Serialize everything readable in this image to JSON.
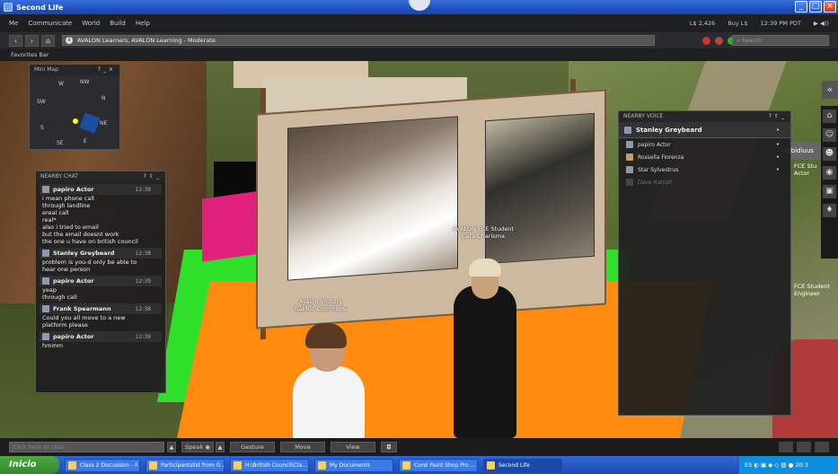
{
  "window": {
    "title": "Second Life"
  },
  "menu": {
    "items": [
      "Me",
      "Communicate",
      "World",
      "Build",
      "Help"
    ],
    "balance": "L$ 2,426",
    "buy": "Buy L$",
    "time": "12:39 PM PDT"
  },
  "nav": {
    "location": "AVALON Learners, AVALON Learning - Moderate",
    "search_placeholder": "Search"
  },
  "favorites": {
    "label": "Favorites Bar"
  },
  "minimap": {
    "title": "Mini Map",
    "compass": {
      "n": "N",
      "nw": "NW",
      "w": "W",
      "sw": "SW",
      "s": "S",
      "se": "SE",
      "e": "E",
      "ne": "NE"
    }
  },
  "chat": {
    "title": "NEARBY CHAT",
    "messages": [
      {
        "name": "papiro Actor",
        "time": "12:38",
        "lines": [
          "i mean phone call",
          "through landline",
          "ereal call",
          "real*",
          "also i tried to email",
          "but the email doesnt work",
          "the one u have on british council"
        ]
      },
      {
        "name": "Stanley Greybeard",
        "time": "12:38",
        "lines": [
          "problem is you-d only be able to",
          "hear one person"
        ]
      },
      {
        "name": "papiro Actor",
        "time": "12:39",
        "lines": [
          "yeap",
          "through call"
        ]
      },
      {
        "name": "Frank Spearmann",
        "time": "12:38",
        "lines": [
          "Could you all move to a new",
          "platform please"
        ]
      },
      {
        "name": "papiro Actor",
        "time": "12:39",
        "lines": [
          "hmmm"
        ]
      }
    ]
  },
  "voice": {
    "title": "NEARBY VOICE",
    "self": "Stanley Greybeard",
    "participants": [
      "papiro Actor",
      "Rossella Fiorenza",
      "Star Sylvestrus",
      "Dave Ratroit"
    ]
  },
  "scene": {
    "tag_visitors": "Avalon Visitors",
    "tag_visitor_name": "Baldric Commons",
    "tag_student": "AVALON FCE Student",
    "tag_student_name": "Cata Charisma",
    "ambidi": "Ambidiuus",
    "fce_top": "FCE Stu",
    "fce_top2": "Actor",
    "fce_bottom": "FCE Student",
    "fce_bottom2": "Engineer"
  },
  "bottom": {
    "chat_placeholder": "Click here to chat.",
    "speak": "Speak",
    "gesture": "Gesture",
    "move": "Move",
    "view": "View"
  },
  "taskbar": {
    "start": "Inicio",
    "tasks": [
      "Class 2 Discussion - F...",
      "Participantslist from G...",
      "H:\\British Council\\Cla...",
      "My Documents",
      "Corel Paint Shop Pro ...",
      "Second Life"
    ],
    "clock": "20:3"
  }
}
